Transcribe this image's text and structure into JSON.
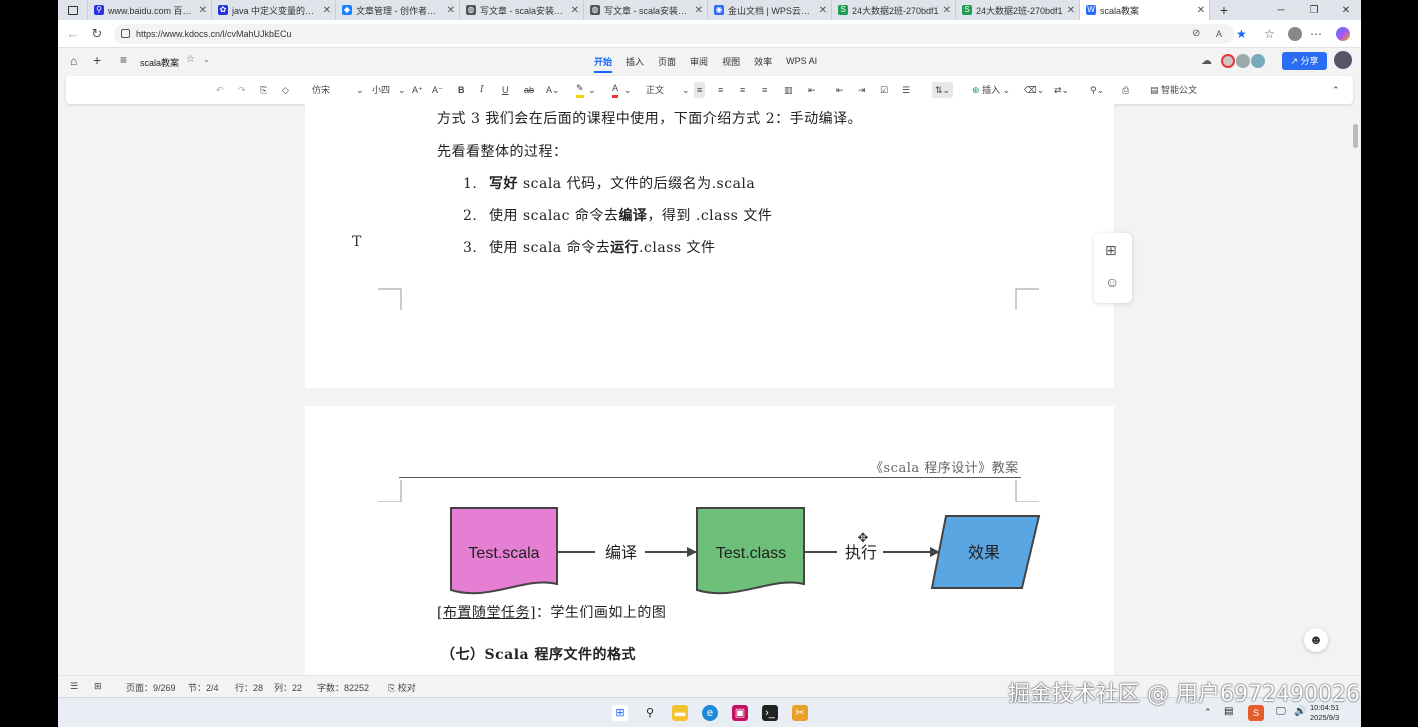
{
  "browser": {
    "tabs": [
      {
        "title": "www.baidu.com 百度一",
        "icon": "search-icon",
        "color": "#2932e1"
      },
      {
        "title": "java 中定义变量的格式",
        "icon": "paw-icon",
        "color": "#2932e1"
      },
      {
        "title": "文章管理 - 创作者中心",
        "icon": "juejin-icon",
        "color": "#1e80ff"
      },
      {
        "title": "写文章 - scala安装和基",
        "icon": "globe-icon",
        "color": "#555555"
      },
      {
        "title": "写文章 - scala安装和基",
        "icon": "globe-icon",
        "color": "#555555"
      },
      {
        "title": "金山文档 | WPS云文档",
        "icon": "kdocs-icon",
        "color": "#2b6cf5"
      },
      {
        "title": "24大数据2班-270bdf1",
        "icon": "sheet-icon",
        "color": "#1f9d55"
      },
      {
        "title": "24大数据2班-270bdf1",
        "icon": "sheet-icon",
        "color": "#1f9d55"
      },
      {
        "title": "scala教案",
        "icon": "word-icon",
        "color": "#2b6cf5",
        "active": true
      }
    ],
    "new_tab": "+",
    "url": "https://www.kdocs.cn/l/cvMahUJkbECu"
  },
  "wps": {
    "doc_title": "scala教案",
    "menu_tabs": [
      "开始",
      "插入",
      "页面",
      "审阅",
      "视图",
      "效率",
      "WPS AI"
    ],
    "active_tab": "开始",
    "share_label": "分享"
  },
  "toolbar": {
    "font_name": "仿宋",
    "font_size": "小四",
    "style": "正文",
    "insert_label": "插入",
    "smart_doc_label": "智能公文"
  },
  "page1": {
    "line1": "方式 3 我们会在后面的课程中使用，下面介绍方式 2：手动编译。",
    "line2": "先看看整体的过程：",
    "items": [
      {
        "num": "1.",
        "pre": "",
        "bold": "写好",
        "post": " scala 代码，文件的后缀名为.scala"
      },
      {
        "num": "2.",
        "pre": "使用 scalac 命令去",
        "bold": "编译",
        "post": "，得到 .class 文件"
      },
      {
        "num": "3.",
        "pre": "使用 scala 命令去",
        "bold": "运行",
        "post": ".class 文件"
      }
    ]
  },
  "page2": {
    "header": "《scala 程序设计》教案",
    "diagram": {
      "node1": "Test.scala",
      "edge1": "编译",
      "node2": "Test.class",
      "edge2": "执行",
      "node3": "效果",
      "colors": {
        "node1": "#e57fd3",
        "node2": "#6dbf7a",
        "node3": "#5aa6e3",
        "stroke": "#444444"
      }
    },
    "task_label": "[布置随堂任务]",
    "task_text": "：学生们画如上的图",
    "section_heading": "（七）Scala 程序文件的格式"
  },
  "status": {
    "page": "页面：9/269",
    "section": "节：2/4",
    "row": "行：28",
    "col": "列：22",
    "words": "字数：82252",
    "proof": "校对"
  },
  "taskbar": {
    "time": "10:04:51",
    "date": "2025/9/3"
  },
  "watermark": "掘金技术社区 @ 用户6972490026"
}
